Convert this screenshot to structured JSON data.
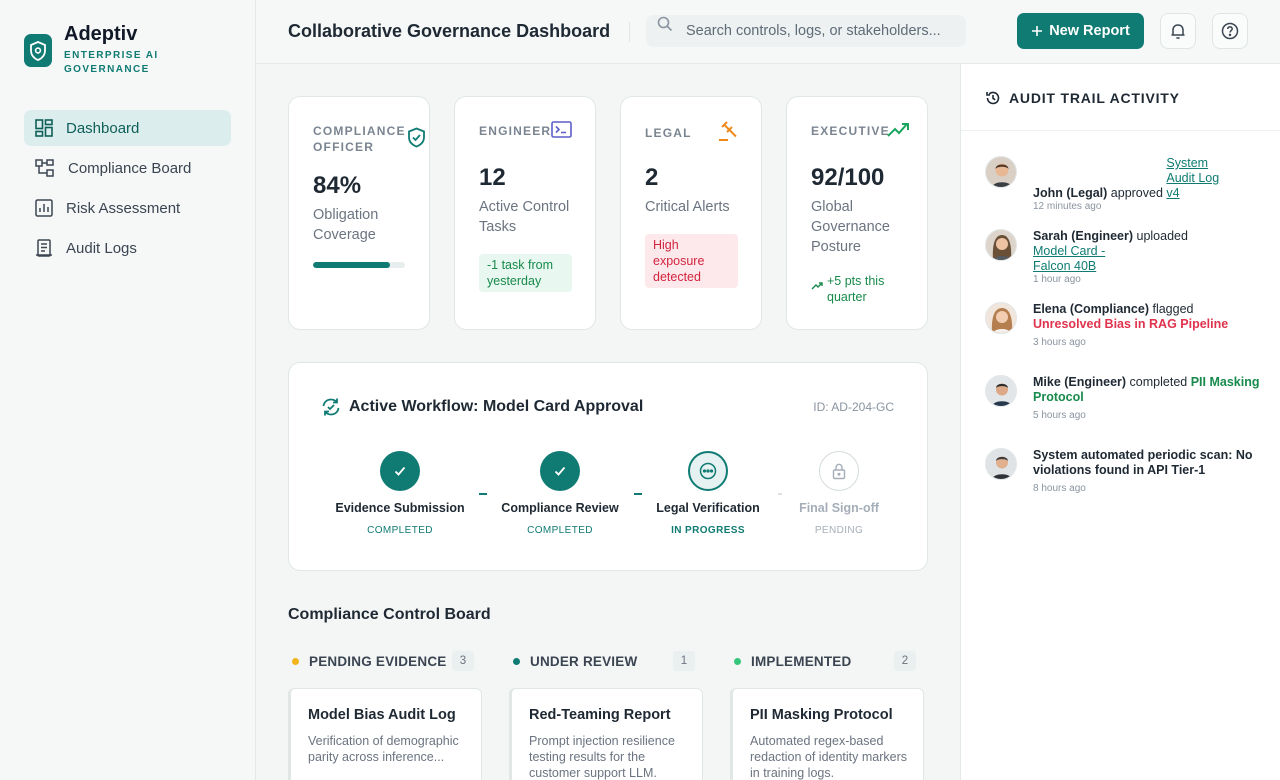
{
  "brand": {
    "name": "Adeptiv",
    "subtitle": "ENTERPRISE AI GOVERNANCE"
  },
  "nav": [
    {
      "label": "Dashboard",
      "active": true
    },
    {
      "label": "Compliance Board"
    },
    {
      "label": "Risk Assessment"
    },
    {
      "label": "Audit Logs"
    }
  ],
  "header": {
    "title": "Collaborative Governance Dashboard",
    "search_placeholder": "Search controls, logs, or stakeholders...",
    "new_report_label": "New Report"
  },
  "kpis": [
    {
      "label": "COMPLIANCE OFFICER",
      "value": "84%",
      "desc": "Obligation Coverage",
      "progress": 0.84,
      "icon": "shield-check-icon"
    },
    {
      "label": "ENGINEER",
      "value": "12",
      "desc": "Active Control Tasks",
      "badge": "-1 task from yesterday",
      "icon": "terminal-icon"
    },
    {
      "label": "LEGAL",
      "value": "2",
      "desc": "Critical Alerts",
      "badge": "High exposure detected",
      "icon": "gavel-icon"
    },
    {
      "label": "EXECUTIVE",
      "value": "92/100",
      "desc": "Global Governance Posture",
      "trend": "+5 pts this quarter",
      "icon": "trending-up-icon"
    }
  ],
  "workflow": {
    "title": "Active Workflow: Model Card Approval",
    "id": "ID: AD-204-GC",
    "steps": [
      {
        "name": "Evidence Submission",
        "status": "COMPLETED"
      },
      {
        "name": "Compliance Review",
        "status": "COMPLETED"
      },
      {
        "name": "Legal Verification",
        "status": "IN PROGRESS"
      },
      {
        "name": "Final Sign-off",
        "status": "PENDING"
      }
    ]
  },
  "board": {
    "title": "Compliance Control Board",
    "columns": [
      {
        "title": "PENDING EVIDENCE",
        "count": "3",
        "color": "#f2b31b",
        "card": {
          "title": "Model Bias Audit Log",
          "desc": "Verification of demographic parity across inference..."
        }
      },
      {
        "title": "UNDER REVIEW",
        "count": "1",
        "color": "#0f7b73",
        "card": {
          "title": "Red-Teaming Report",
          "desc": "Prompt injection resilience testing results for the customer support LLM."
        }
      },
      {
        "title": "IMPLEMENTED",
        "count": "2",
        "color": "#34c77b",
        "card": {
          "title": "PII Masking Protocol",
          "desc": "Automated regex-based redaction of identity markers in training logs."
        }
      }
    ]
  },
  "audit": {
    "title": "AUDIT TRAIL ACTIVITY",
    "items": [
      {
        "actor": "John (Legal)",
        "action": " approved ",
        "target": "System Audit Log v4",
        "time": "12 minutes ago"
      },
      {
        "actor": "Sarah (Engineer)",
        "action": " uploaded ",
        "target": "Model Card - Falcon 40B",
        "time": "1 hour ago"
      },
      {
        "actor": "Elena (Compliance)",
        "action": " flagged ",
        "target": "Unresolved Bias in RAG Pipeline",
        "time": "3 hours ago"
      },
      {
        "actor": "Mike (Engineer)",
        "action": " completed ",
        "target": "PII Masking Protocol",
        "time": "5 hours ago"
      },
      {
        "actor": "System automated periodic scan: No violations found in API Tier-1",
        "time": "8 hours ago"
      }
    ]
  },
  "colors": {
    "accent": "#0f7b73",
    "danger": "#e0334d",
    "success": "#178a4c",
    "warning": "#f2b31b"
  }
}
